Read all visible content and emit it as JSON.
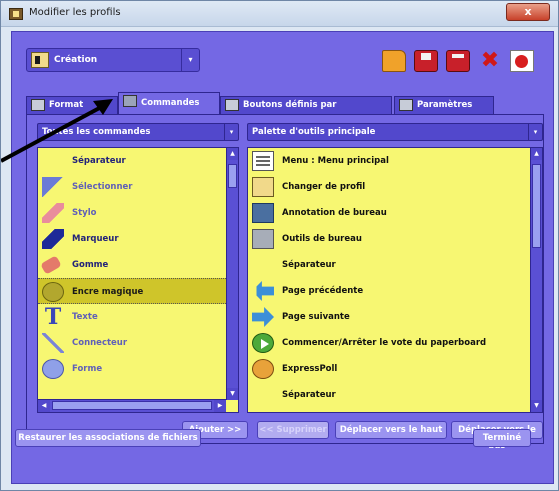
{
  "window": {
    "title": "Modifier les profils",
    "close_label": "x"
  },
  "profile": {
    "selected": "Création"
  },
  "toolbar": {
    "icons": [
      "open-folder-icon",
      "save-icon",
      "save-as-icon",
      "delete-icon",
      "reset-icon"
    ]
  },
  "tabs": [
    {
      "label": "Format"
    },
    {
      "label": "Commandes"
    },
    {
      "label": "Boutons définis par l'utilisateur"
    },
    {
      "label": "Paramètres"
    }
  ],
  "left_list": {
    "header": "Toutes les commandes",
    "items": [
      {
        "label": "Séparateur",
        "icon": "none"
      },
      {
        "label": "Sélectionner",
        "icon": "cursor-icon"
      },
      {
        "label": "Stylo",
        "icon": "pen-icon"
      },
      {
        "label": "Marqueur",
        "icon": "marker-icon"
      },
      {
        "label": "Gomme",
        "icon": "eraser-icon"
      },
      {
        "label": "Encre magique",
        "icon": "magic-ink-icon"
      },
      {
        "label": "Texte",
        "icon": "text-icon"
      },
      {
        "label": "Connecteur",
        "icon": "connector-icon"
      },
      {
        "label": "Forme",
        "icon": "shape-icon"
      }
    ]
  },
  "right_list": {
    "header": "Palette d'outils principale",
    "items": [
      {
        "label": "Menu : Menu principal",
        "icon": "menu-icon"
      },
      {
        "label": "Changer de profil",
        "icon": "profile-icon"
      },
      {
        "label": "Annotation de bureau",
        "icon": "desktop-annotation-icon"
      },
      {
        "label": "Outils de bureau",
        "icon": "desktop-tools-icon"
      },
      {
        "label": "Séparateur",
        "icon": "none"
      },
      {
        "label": "Page précédente",
        "icon": "previous-page-icon"
      },
      {
        "label": "Page suivante",
        "icon": "next-page-icon"
      },
      {
        "label": "Commencer/Arrêter le vote du paperboard",
        "icon": "vote-icon"
      },
      {
        "label": "ExpressPoll",
        "icon": "expresspoll-icon"
      },
      {
        "label": "Séparateur",
        "icon": "none"
      }
    ]
  },
  "actions": {
    "add": "Ajouter >>",
    "remove": "<< Supprimer",
    "move_up": "Déplacer vers le haut",
    "move_down": "Déplacer vers le bas"
  },
  "footer": {
    "restore": "Restaurer les associations de fichiers",
    "done": "Terminé"
  },
  "colors": {
    "panel": "#7468e4",
    "list_bg": "#f7f772",
    "selected_bg": "#cfc52a",
    "header_bg": "#5248cc"
  }
}
